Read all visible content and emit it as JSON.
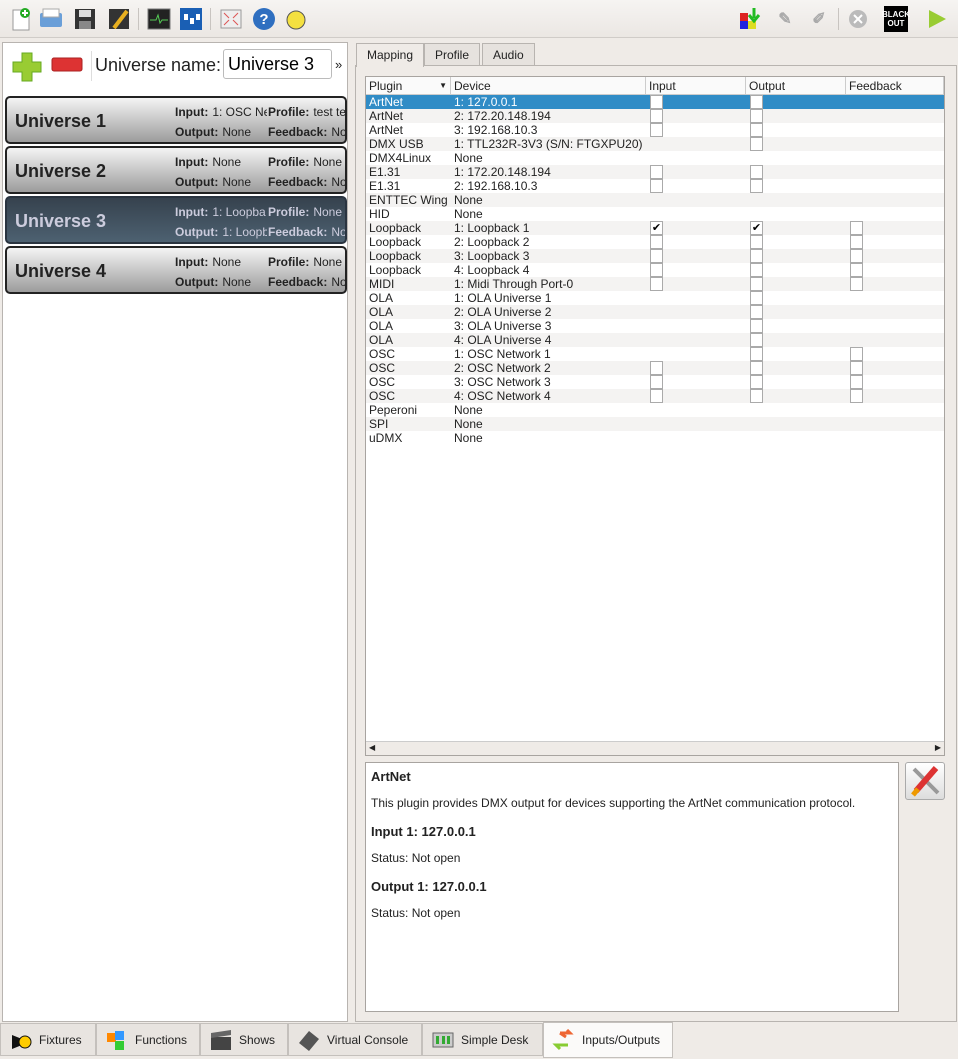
{
  "toolbar": {
    "left": [
      "new-document-icon",
      "open-icon",
      "save-icon",
      "save-as-icon",
      "monitor-icon",
      "dip-switch-icon",
      "fullscreen-icon",
      "help-icon",
      "bulb-icon"
    ],
    "right": [
      "dmx-dump-icon",
      "live-edit-icon",
      "edit-icon",
      "stop-all-icon",
      "blackout-icon",
      "play-icon"
    ],
    "blackout_label_1": "BLACK",
    "blackout_label_2": "OUT"
  },
  "universe_panel": {
    "name_label": "Universe name:",
    "name_value": "Universe 3",
    "more": "»",
    "labels": {
      "input": "Input:",
      "output": "Output:",
      "profile": "Profile:",
      "feedback": "Feedback:"
    },
    "universes": [
      {
        "name": "Universe 1",
        "input": "1: OSC Ne",
        "output": "None",
        "profile": "test te",
        "feedback": "No"
      },
      {
        "name": "Universe 2",
        "input": "None",
        "output": "None",
        "profile": "None",
        "feedback": "No"
      },
      {
        "name": "Universe 3",
        "input": "1: Loopba",
        "output": "1: Loopb",
        "profile": "None",
        "feedback": "No"
      },
      {
        "name": "Universe 4",
        "input": "None",
        "output": "None",
        "profile": "None",
        "feedback": "No"
      }
    ]
  },
  "tabs": [
    "Mapping",
    "Profile",
    "Audio"
  ],
  "table": {
    "headers": [
      "Plugin",
      "Device",
      "Input",
      "Output",
      "Feedback"
    ],
    "rows": [
      [
        "ArtNet",
        "1: 127.0.0.1",
        0,
        0,
        null
      ],
      [
        "ArtNet",
        "2: 172.20.148.194",
        0,
        0,
        null
      ],
      [
        "ArtNet",
        "3: 192.168.10.3",
        0,
        0,
        null
      ],
      [
        "DMX USB",
        "1: TTL232R-3V3 (S/N: FTGXPU20)",
        null,
        0,
        null
      ],
      [
        "DMX4Linux",
        "None",
        null,
        null,
        null
      ],
      [
        "E1.31",
        "1: 172.20.148.194",
        0,
        0,
        null
      ],
      [
        "E1.31",
        "2: 192.168.10.3",
        0,
        0,
        null
      ],
      [
        "ENTTEC Wing",
        "None",
        null,
        null,
        null
      ],
      [
        "HID",
        "None",
        null,
        null,
        null
      ],
      [
        "Loopback",
        "1: Loopback 1",
        1,
        1,
        0
      ],
      [
        "Loopback",
        "2: Loopback 2",
        0,
        0,
        0
      ],
      [
        "Loopback",
        "3: Loopback 3",
        0,
        0,
        0
      ],
      [
        "Loopback",
        "4: Loopback 4",
        0,
        0,
        0
      ],
      [
        "MIDI",
        "1: Midi Through Port-0",
        0,
        0,
        0
      ],
      [
        "OLA",
        "1: OLA Universe 1",
        null,
        0,
        null
      ],
      [
        "OLA",
        "2: OLA Universe 2",
        null,
        0,
        null
      ],
      [
        "OLA",
        "3: OLA Universe 3",
        null,
        0,
        null
      ],
      [
        "OLA",
        "4: OLA Universe 4",
        null,
        0,
        null
      ],
      [
        "OSC",
        "1: OSC Network 1",
        null,
        0,
        0
      ],
      [
        "OSC",
        "2: OSC Network 2",
        0,
        0,
        0
      ],
      [
        "OSC",
        "3: OSC Network 3",
        0,
        0,
        0
      ],
      [
        "OSC",
        "4: OSC Network 4",
        0,
        0,
        0
      ],
      [
        "Peperoni",
        "None",
        null,
        null,
        null
      ],
      [
        "SPI",
        "None",
        null,
        null,
        null
      ],
      [
        "uDMX",
        "None",
        null,
        null,
        null
      ]
    ],
    "selected_row": 0
  },
  "info": {
    "title": "ArtNet",
    "description": "This plugin provides DMX output for devices supporting the ArtNet communication protocol.",
    "input_heading": "Input 1: 127.0.0.1",
    "input_status": "Status: Not open",
    "output_heading": "Output 1: 127.0.0.1",
    "output_status": "Status: Not open"
  },
  "bottom_tabs": [
    "Fixtures",
    "Functions",
    "Shows",
    "Virtual Console",
    "Simple Desk",
    "Inputs/Outputs"
  ],
  "active_bottom_tab": "Inputs/Outputs",
  "colors": {
    "selection": "#308cc6",
    "selected_universe": "#3e4f5e"
  }
}
